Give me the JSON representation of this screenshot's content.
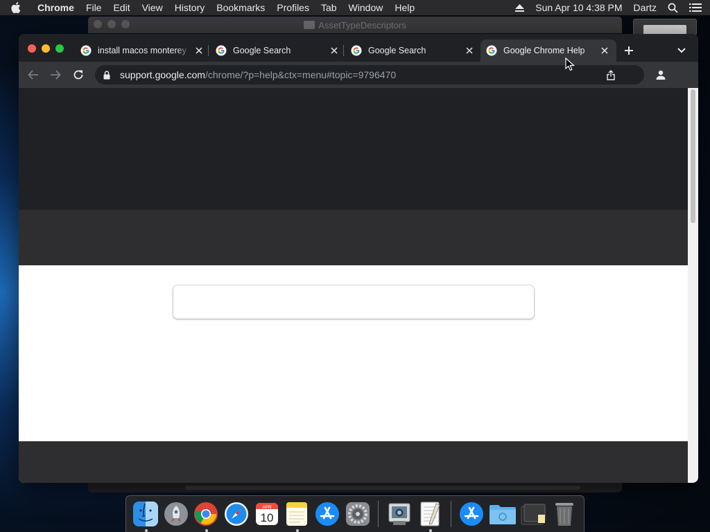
{
  "menubar": {
    "items": [
      "Chrome",
      "File",
      "Edit",
      "View",
      "History",
      "Bookmarks",
      "Profiles",
      "Tab",
      "Window",
      "Help"
    ],
    "clock": "Sun Apr 10  4:38 PM",
    "user": "Dartz"
  },
  "background_window": {
    "title": "AssetTypeDescriptors"
  },
  "tabs": [
    {
      "title": "install macos monterey",
      "active": false
    },
    {
      "title": "Google Search",
      "active": false
    },
    {
      "title": "Google Search",
      "active": false
    },
    {
      "title": "Google Chrome Help",
      "active": true
    }
  ],
  "omnibox": {
    "host": "support.google.com",
    "path": "/chrome/?p=help&ctx=menu#topic=9796470"
  },
  "page": {
    "search_placeholder": ""
  },
  "dock": {
    "apps": [
      {
        "name": "Finder",
        "running": true
      },
      {
        "name": "Launchpad",
        "running": false
      },
      {
        "name": "Google Chrome",
        "running": true
      },
      {
        "name": "Safari",
        "running": false
      },
      {
        "name": "Calendar",
        "running": false
      },
      {
        "name": "Notes",
        "running": true
      },
      {
        "name": "App Store",
        "running": false
      },
      {
        "name": "System Preferences",
        "running": false
      },
      {
        "name": "Preview",
        "running": false
      },
      {
        "name": "TextEdit",
        "running": true
      },
      {
        "name": "Applications",
        "running": false
      },
      {
        "name": "Downloads",
        "running": false
      },
      {
        "name": "Documents",
        "running": false
      },
      {
        "name": "Trash",
        "running": false
      }
    ],
    "calendar_month": "APR",
    "calendar_day": "10"
  },
  "colors": {
    "tabstrip": "#202124",
    "toolbar": "#35363a",
    "page_header": "#202124",
    "page_band": "#2e2e30",
    "page_body": "#ffffff"
  }
}
